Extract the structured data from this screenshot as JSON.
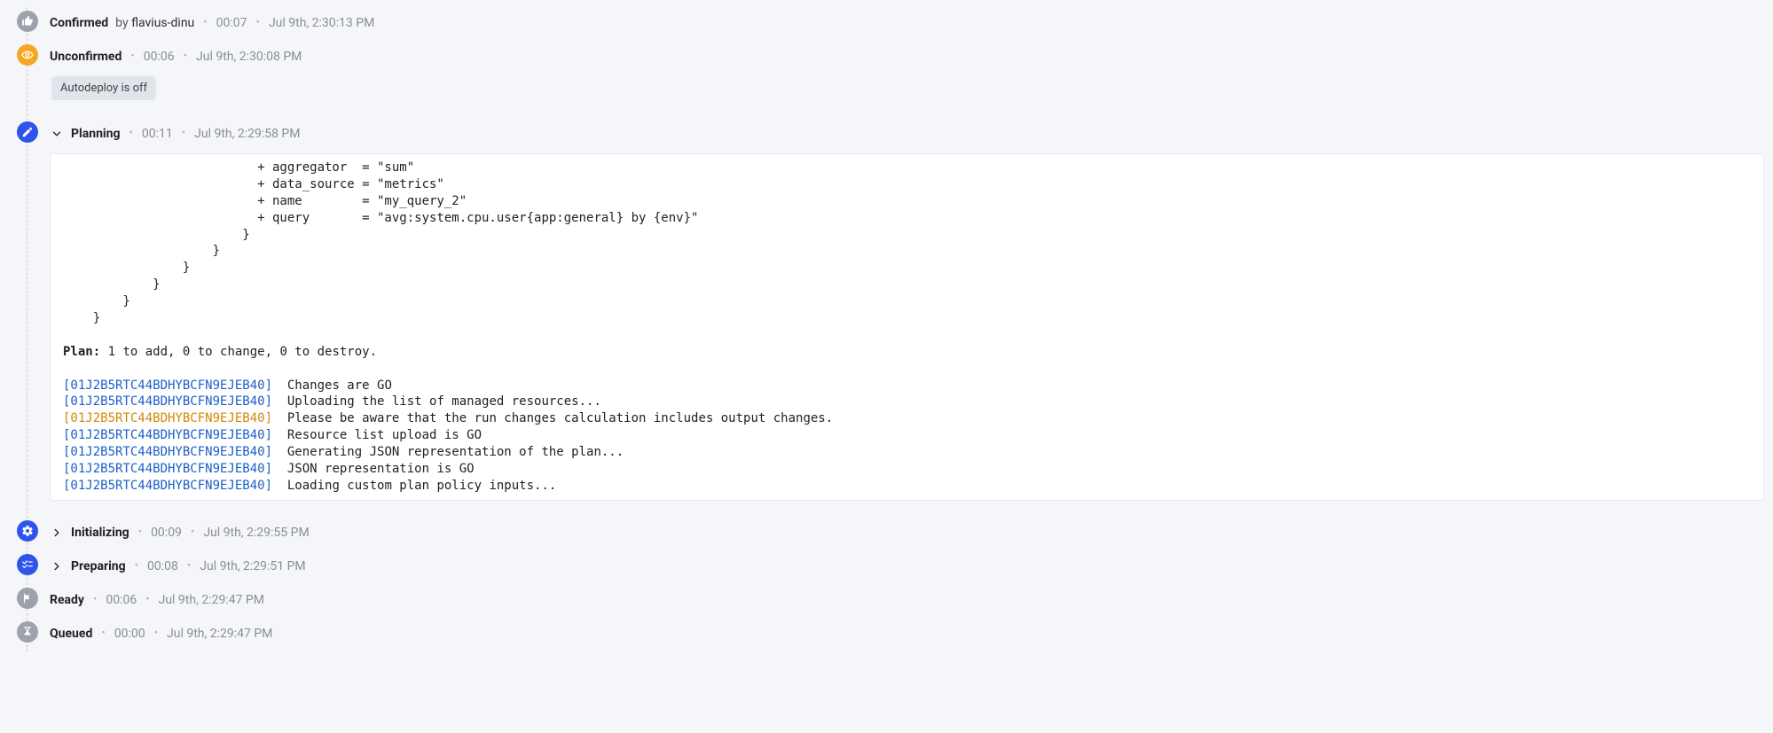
{
  "colors": {
    "gray": "#9ea1ac",
    "blue": "#2f54eb",
    "orange": "#f5a623",
    "log_id_blue": "#1d5ec7",
    "log_id_orange": "#d48806"
  },
  "steps": {
    "confirmed": {
      "title": "Confirmed",
      "by_label": "by",
      "user": "flavius-dinu",
      "duration": "00:07",
      "timestamp": "Jul 9th, 2:30:13 PM"
    },
    "unconfirmed": {
      "title": "Unconfirmed",
      "duration": "00:06",
      "timestamp": "Jul 9th, 2:30:08 PM",
      "badge": "Autodeploy is off"
    },
    "planning": {
      "title": "Planning",
      "duration": "00:11",
      "timestamp": "Jul 9th, 2:29:58 PM"
    },
    "initializing": {
      "title": "Initializing",
      "duration": "00:09",
      "timestamp": "Jul 9th, 2:29:55 PM"
    },
    "preparing": {
      "title": "Preparing",
      "duration": "00:08",
      "timestamp": "Jul 9th, 2:29:51 PM"
    },
    "ready": {
      "title": "Ready",
      "duration": "00:06",
      "timestamp": "Jul 9th, 2:29:47 PM"
    },
    "queued": {
      "title": "Queued",
      "duration": "00:00",
      "timestamp": "Jul 9th, 2:29:47 PM"
    }
  },
  "planning_log": {
    "preamble": [
      "                          + aggregator  = \"sum\"",
      "                          + data_source = \"metrics\"",
      "                          + name        = \"my_query_2\"",
      "                          + query       = \"avg:system.cpu.user{app:general} by {env}\"",
      "                        }",
      "                    }",
      "                }",
      "            }",
      "        }",
      "    }"
    ],
    "plan_summary_label": "Plan:",
    "plan_summary_text": " 1 to add, 0 to change, 0 to destroy.",
    "log_id": "[01J2B5RTC44BDHYBCFN9EJEB40]",
    "lines": [
      {
        "style": "blue",
        "text": "  Changes are GO"
      },
      {
        "style": "blue",
        "text": "  Uploading the list of managed resources..."
      },
      {
        "style": "orange",
        "text": "  Please be aware that the run changes calculation includes output changes."
      },
      {
        "style": "blue",
        "text": "  Resource list upload is GO"
      },
      {
        "style": "blue",
        "text": "  Generating JSON representation of the plan..."
      },
      {
        "style": "blue",
        "text": "  JSON representation is GO"
      },
      {
        "style": "blue",
        "text": "  Loading custom plan policy inputs..."
      }
    ]
  }
}
